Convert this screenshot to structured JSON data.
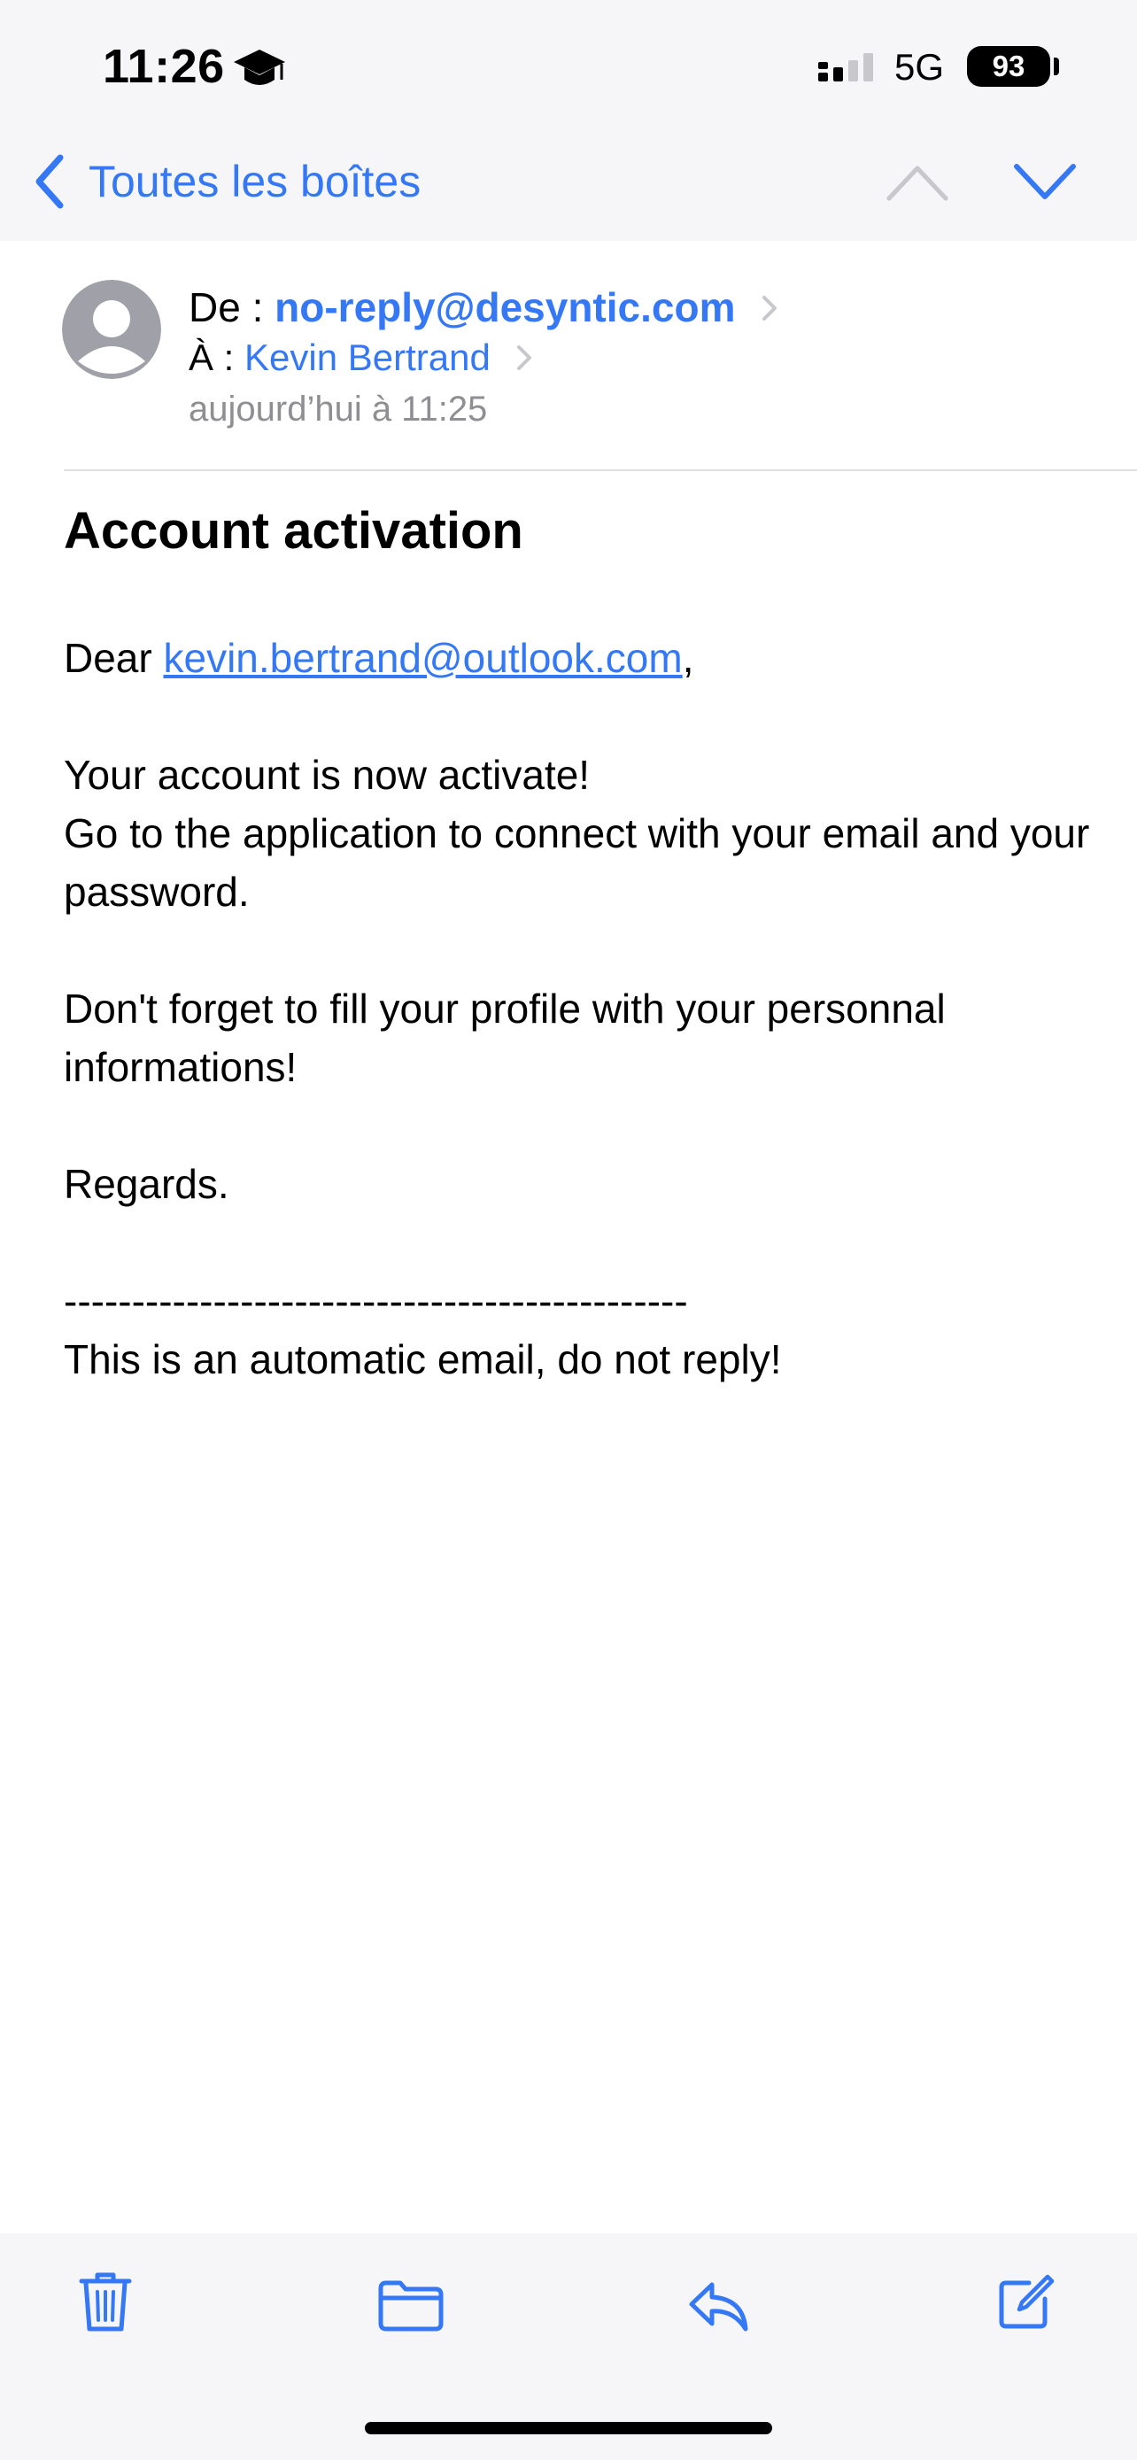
{
  "status_bar": {
    "time": "11:26",
    "network": "5G",
    "battery": "93"
  },
  "nav": {
    "back_label": "Toutes les boîtes"
  },
  "header": {
    "from_label": "De :",
    "from_value": "no-reply@desyntic.com",
    "to_label": "À :",
    "to_value": "Kevin Bertrand",
    "date": "aujourd’hui à 11:25"
  },
  "message": {
    "subject": "Account activation",
    "greeting_prefix": "Dear ",
    "greeting_link": "kevin.bertrand@outlook.com",
    "greeting_suffix": ",",
    "line1": "Your account is now activate!",
    "line2": "Go to the application to connect with your email and your password.",
    "line3": "Don't forget to fill your profile with your personnal informations!",
    "line4": "Regards.",
    "separator": "----------------------------------------------",
    "footer": "This is an automatic email, do not reply!"
  },
  "colors": {
    "accent": "#3478f6",
    "secondary_text": "#8e8e93",
    "bar_background": "#f6f6f8"
  },
  "icons": {
    "status": [
      "graduation-cap-icon",
      "signal-icon",
      "battery-icon"
    ],
    "nav": [
      "chevron-left-icon",
      "chevron-up-icon",
      "chevron-down-icon"
    ],
    "toolbar": [
      "trash-icon",
      "folder-icon",
      "reply-icon",
      "compose-icon"
    ]
  }
}
